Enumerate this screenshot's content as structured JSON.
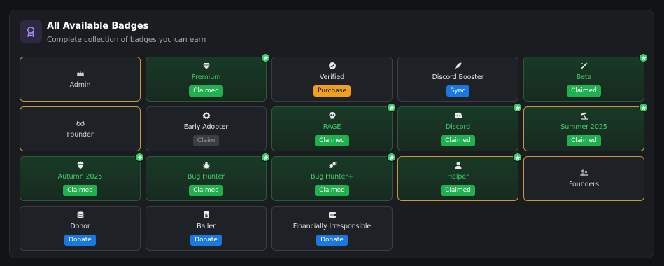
{
  "header": {
    "title": "All Available Badges",
    "subtitle": "Complete collection of badges you can earn",
    "icon": "award-icon"
  },
  "colors": {
    "accent_green": "#1fb04f",
    "accent_gold": "#c59a3a",
    "purchase": "#f0a020",
    "sync": "#1a78e0"
  },
  "badges": [
    {
      "name": "Admin",
      "icon": "crown-icon",
      "action": "",
      "style": "gold",
      "starred": false
    },
    {
      "name": "Premium",
      "icon": "diamond-icon",
      "action": "Claimed",
      "style": "claimed",
      "starred": true
    },
    {
      "name": "Verified",
      "icon": "verified-icon",
      "action": "Purchase",
      "style": "default",
      "starred": false
    },
    {
      "name": "Discord Booster",
      "icon": "rocket-icon",
      "action": "Sync",
      "style": "default",
      "starred": false
    },
    {
      "name": "Beta",
      "icon": "magic-wand-icon",
      "action": "Claimed",
      "style": "claimed",
      "starred": true
    },
    {
      "name": "Founder",
      "icon": "glasses-icon",
      "action": "",
      "style": "gold",
      "starred": false
    },
    {
      "name": "Early Adopter",
      "icon": "badge-check-icon",
      "action": "Claim",
      "style": "default",
      "starred": false
    },
    {
      "name": "RAGE",
      "icon": "skull-icon",
      "action": "Claimed",
      "style": "claimed",
      "starred": true
    },
    {
      "name": "Discord",
      "icon": "discord-icon",
      "action": "Claimed",
      "style": "claimed",
      "starred": true
    },
    {
      "name": "Summer 2025",
      "icon": "umbrella-beach-icon",
      "action": "Claimed",
      "style": "claimed-gold",
      "starred": true
    },
    {
      "name": "Autumn 2025",
      "icon": "acorn-icon",
      "action": "Claimed",
      "style": "claimed",
      "starred": true
    },
    {
      "name": "Bug Hunter",
      "icon": "bug-icon",
      "action": "Claimed",
      "style": "claimed",
      "starred": true
    },
    {
      "name": "Bug Hunter+",
      "icon": "bugs-icon",
      "action": "Claimed",
      "style": "claimed",
      "starred": true
    },
    {
      "name": "Helper",
      "icon": "user-icon",
      "action": "Claimed",
      "style": "claimed-gold",
      "starred": true
    },
    {
      "name": "Founders",
      "icon": "users-icon",
      "action": "",
      "style": "gold",
      "starred": false
    },
    {
      "name": "Donor",
      "icon": "coins-icon",
      "action": "Donate",
      "style": "default",
      "starred": false
    },
    {
      "name": "Baller",
      "icon": "money-hand-icon",
      "action": "Donate",
      "style": "default",
      "starred": false
    },
    {
      "name": "Financially Irresponsible",
      "icon": "wallet-icon",
      "action": "Donate",
      "style": "default",
      "starred": false
    }
  ]
}
